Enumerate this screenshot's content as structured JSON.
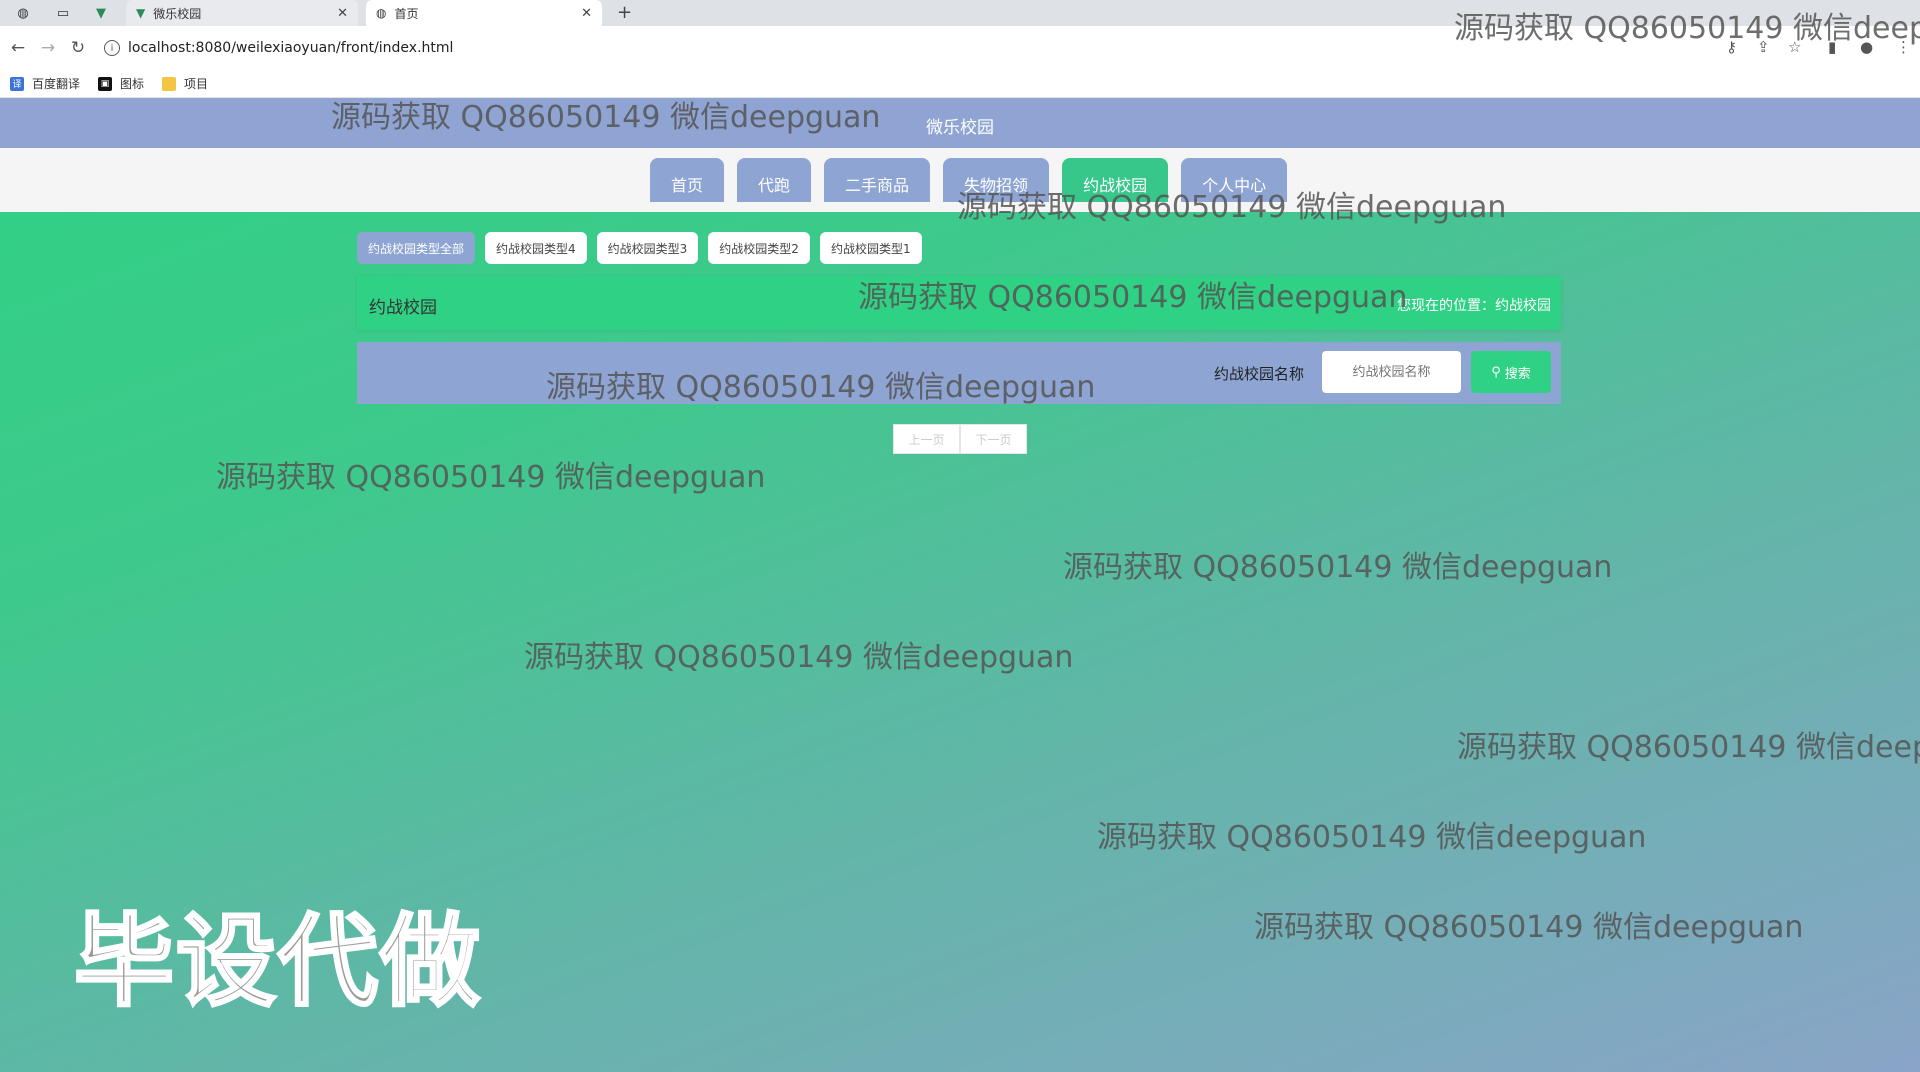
{
  "browser": {
    "tabs": [
      {
        "label": "微乐校园",
        "active": false
      },
      {
        "label": "首页",
        "active": true
      }
    ],
    "url": "localhost:8080/weilexiaoyuan/front/index.html",
    "bookmarks": [
      "百度翻译",
      "图标",
      "项目"
    ]
  },
  "site": {
    "title": "微乐校园",
    "nav": [
      "首页",
      "代跑",
      "二手商品",
      "失物招领",
      "约战校园",
      "个人中心"
    ],
    "nav_active": "约战校园"
  },
  "filters": {
    "items": [
      "约战校园类型全部",
      "约战校园类型4",
      "约战校园类型3",
      "约战校园类型2",
      "约战校园类型1"
    ],
    "active": "约战校园类型全部"
  },
  "breadcrumb": {
    "title": "约战校园",
    "location": "您现在的位置：约战校园"
  },
  "search": {
    "label": "约战校园名称",
    "placeholder": "约战校园名称",
    "button": "搜索"
  },
  "pager": {
    "prev": "上一页",
    "next": "下一页"
  },
  "watermark": {
    "text": "源码获取 QQ86050149 微信deepguan",
    "text_cut": "源码获取 QQ86050149 微信deep",
    "big": "毕设代做"
  },
  "colors": {
    "header_bg": "#8fa4d2",
    "accent_green": "#2fd184",
    "nav_btn": "#8ea4d2"
  }
}
